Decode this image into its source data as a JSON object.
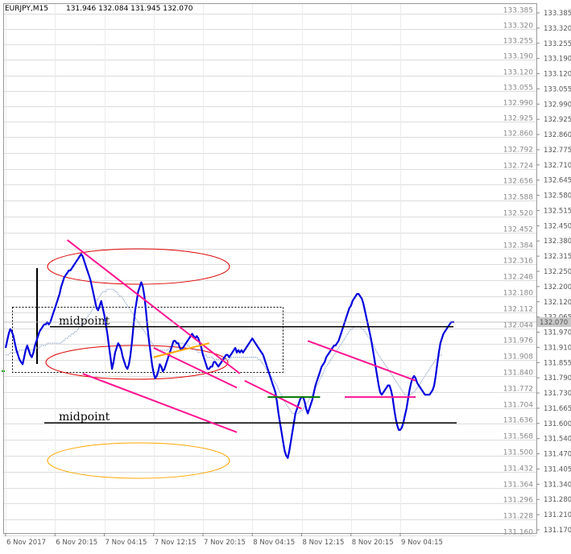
{
  "header": {
    "symbol": "EURJPY,M15",
    "ohlc": "131.946 132.084 131.945 132.070"
  },
  "price_tag": "132.070",
  "colors": {
    "price_line": "#0000dd",
    "ma_line": "#9bb0d0",
    "trendline": "#ff1493",
    "level_line": "#000000",
    "green_line": "#007700",
    "orange_line": "#ffa500",
    "ellipse_red": "#dd0000",
    "ellipse_orange": "#ffa500",
    "grid": "#dcdcdc"
  },
  "chart_data": {
    "type": "line",
    "symbol": "EURJPY",
    "timeframe": "M15",
    "y_axis_ticks": [
      "133.385",
      "133.320",
      "133.255",
      "133.190",
      "133.120",
      "133.055",
      "132.990",
      "132.925",
      "132.860",
      "132.792",
      "132.724",
      "132.656",
      "132.588",
      "132.520",
      "132.452",
      "132.384",
      "132.316",
      "132.248",
      "132.180",
      "132.112",
      "132.044",
      "131.976",
      "131.908",
      "131.840",
      "131.772",
      "131.704",
      "131.636",
      "131.568",
      "131.500",
      "131.432",
      "131.364",
      "131.296",
      "131.228",
      "131.160"
    ],
    "y_axis_ticks_right": [
      "133.385",
      "133.320",
      "133.255",
      "133.190",
      "133.120",
      "133.055",
      "132.990",
      "132.925",
      "132.860",
      "132.775",
      "132.710",
      "132.645",
      "132.580",
      "132.515",
      "132.450",
      "132.380",
      "132.315",
      "132.250",
      "132.200",
      "132.120",
      "132.065",
      "131.970",
      "131.910",
      "131.855",
      "131.790",
      "131.730",
      "131.665",
      "131.600",
      "131.540",
      "131.470",
      "131.405",
      "131.340",
      "131.280",
      "131.210",
      "131.170"
    ],
    "x_axis_ticks": [
      "6 Nov 2017",
      "6 Nov 20:15",
      "7 Nov 04:15",
      "7 Nov 12:15",
      "7 Nov 20:15",
      "8 Nov 04:15",
      "8 Nov 12:15",
      "8 Nov 20:15",
      "9 Nov 04:15"
    ],
    "x_tick_index": [
      0,
      32,
      64,
      96,
      128,
      160,
      192,
      224,
      256
    ],
    "ylim": [
      131.17,
      133.43
    ],
    "annotations": [
      "midpoint",
      "midpoint"
    ],
    "series": [
      {
        "values": [
          131.96,
          131.99,
          132.02,
          132.04,
          132.03,
          132.01,
          131.98,
          131.95,
          131.93,
          131.91,
          131.9,
          131.89,
          131.92,
          131.95,
          131.97,
          131.95,
          131.93,
          131.92,
          131.94,
          131.97,
          131.99,
          132.01,
          132.03,
          132.04,
          132.05,
          132.06,
          132.06,
          132.07,
          132.06,
          132.07,
          132.09,
          132.11,
          132.13,
          132.15,
          132.17,
          132.19,
          132.22,
          132.24,
          132.26,
          132.27,
          132.28,
          132.29,
          132.29,
          132.3,
          132.31,
          132.32,
          132.33,
          132.34,
          132.35,
          132.36,
          132.35,
          132.33,
          132.31,
          132.29,
          132.27,
          132.25,
          132.22,
          132.19,
          132.16,
          132.13,
          132.12,
          132.14,
          132.16,
          132.13,
          132.1,
          132.06,
          132.02,
          131.97,
          131.92,
          131.87,
          131.9,
          131.94,
          131.96,
          131.98,
          131.97,
          131.95,
          131.92,
          131.9,
          131.88,
          131.87,
          131.89,
          131.93,
          131.99,
          132.06,
          132.12,
          132.16,
          132.2,
          132.22,
          132.24,
          132.22,
          132.18,
          132.12,
          132.05,
          131.99,
          131.94,
          131.89,
          131.85,
          131.83,
          131.84,
          131.86,
          131.89,
          131.88,
          131.86,
          131.87,
          131.89,
          131.91,
          131.93,
          131.95,
          131.97,
          131.99,
          131.99,
          131.98,
          131.98,
          131.96,
          131.95,
          131.96,
          131.97,
          131.98,
          131.99,
          132.0,
          132.01,
          132.02,
          132.01,
          132.0,
          132.01,
          132.0,
          131.98,
          131.96,
          131.93,
          131.91,
          131.89,
          131.87,
          131.87,
          131.88,
          131.88,
          131.9,
          131.9,
          131.89,
          131.88,
          131.89,
          131.9,
          131.91,
          131.92,
          131.93,
          131.93,
          131.92,
          131.93,
          131.94,
          131.95,
          131.96,
          131.94,
          131.95,
          131.94,
          131.95,
          131.94,
          131.95,
          131.96,
          131.97,
          131.98,
          131.99,
          132.0,
          131.99,
          131.98,
          131.97,
          131.96,
          131.95,
          131.94,
          131.93,
          131.91,
          131.89,
          131.87,
          131.85,
          131.83,
          131.81,
          131.79,
          131.77,
          131.73,
          131.68,
          131.64,
          131.6,
          131.56,
          131.52,
          131.5,
          131.49,
          131.52,
          131.56,
          131.6,
          131.64,
          131.68,
          131.7,
          131.72,
          131.74,
          131.75,
          131.75,
          131.73,
          131.7,
          131.68,
          131.7,
          131.72,
          131.74,
          131.77,
          131.8,
          131.82,
          131.84,
          131.86,
          131.88,
          131.89,
          131.9,
          131.92,
          131.93,
          131.94,
          131.95,
          131.96,
          131.97,
          131.97,
          131.98,
          131.99,
          132.01,
          132.03,
          132.05,
          132.07,
          132.09,
          132.11,
          132.13,
          132.14,
          132.16,
          132.17,
          132.18,
          132.19,
          132.19,
          132.18,
          132.17,
          132.15,
          132.12,
          132.09,
          132.06,
          132.03,
          132.0,
          131.96,
          131.92,
          131.88,
          131.84,
          131.8,
          131.77,
          131.76,
          131.77,
          131.78,
          131.79,
          131.8,
          131.8,
          131.78,
          131.75,
          131.7,
          131.66,
          131.63,
          131.61,
          131.61,
          131.62,
          131.64,
          131.67,
          131.7,
          131.74,
          131.78,
          131.81,
          131.83,
          131.84,
          131.83,
          131.81,
          131.8,
          131.79,
          131.78,
          131.77,
          131.76,
          131.76,
          131.76,
          131.76,
          131.77,
          131.78,
          131.8,
          131.84,
          131.89,
          131.94,
          131.98,
          132.0,
          132.02,
          132.03,
          132.04,
          132.05,
          132.06,
          132.07,
          132.07,
          132.07
        ]
      },
      {
        "values": [
          131.93,
          131.93,
          131.93,
          131.94,
          131.94,
          131.94,
          131.94,
          131.94,
          131.94,
          131.95,
          131.95,
          131.95,
          131.95,
          131.95,
          131.95,
          131.95,
          131.95,
          131.95,
          131.95,
          131.96,
          131.96,
          131.96,
          131.96,
          131.97,
          131.97,
          131.97,
          131.97,
          131.98,
          131.98,
          131.98,
          131.98,
          131.98,
          131.98,
          131.98,
          131.98,
          131.98,
          131.98,
          131.99,
          131.99,
          132.0,
          132.0,
          132.01,
          132.01,
          132.02,
          132.02,
          132.03,
          132.03,
          132.04,
          132.05,
          132.06,
          132.06,
          132.07,
          132.08,
          132.09,
          132.1,
          132.11,
          132.12,
          132.14,
          132.15,
          132.16,
          132.17,
          132.18,
          132.19,
          132.2,
          132.2,
          132.2,
          132.21,
          132.21,
          132.21,
          132.21,
          132.21,
          132.2,
          132.2,
          132.19,
          132.18,
          132.18,
          132.17,
          132.16,
          132.15,
          132.14,
          132.13,
          132.12,
          132.11,
          132.1,
          132.09,
          132.08,
          132.07,
          132.06,
          132.05,
          132.04,
          132.03,
          132.02,
          132.01,
          132.0,
          131.99,
          131.98,
          131.97,
          131.96,
          131.96,
          131.95,
          131.95,
          131.95,
          131.95,
          131.95,
          131.95,
          131.95,
          131.96,
          131.96,
          131.97,
          131.97,
          131.97,
          131.98,
          131.98,
          131.98,
          131.98,
          131.98,
          131.98,
          131.98,
          131.97,
          131.97,
          131.96,
          131.96,
          131.96,
          131.95,
          131.95,
          131.94,
          131.94,
          131.94,
          131.93,
          131.93,
          131.93,
          131.92,
          131.92,
          131.92,
          131.92,
          131.91,
          131.91,
          131.91,
          131.91,
          131.91,
          131.91,
          131.91,
          131.91,
          131.91,
          131.91,
          131.91,
          131.92,
          131.92,
          131.92,
          131.92,
          131.92,
          131.92,
          131.92,
          131.92,
          131.92,
          131.92,
          131.92,
          131.92,
          131.92,
          131.92,
          131.92,
          131.92,
          131.92,
          131.92,
          131.91,
          131.91,
          131.9,
          131.89,
          131.88,
          131.87,
          131.86,
          131.85,
          131.84,
          131.83,
          131.82,
          131.81,
          131.8,
          131.78,
          131.77,
          131.76,
          131.74,
          131.73,
          131.72,
          131.71,
          131.7,
          131.69,
          131.68,
          131.68,
          131.68,
          131.68,
          131.68,
          131.69,
          131.69,
          131.7,
          131.71,
          131.72,
          131.73,
          131.74,
          131.75,
          131.76,
          131.77,
          131.79,
          131.8,
          131.81,
          131.83,
          131.84,
          131.85,
          131.87,
          131.88,
          131.89,
          131.9,
          131.91,
          131.92,
          131.93,
          131.94,
          131.95,
          131.96,
          131.97,
          131.98,
          131.99,
          132.0,
          132.01,
          132.02,
          132.03,
          132.04,
          132.04,
          132.05,
          132.05,
          132.05,
          132.05,
          132.05,
          132.04,
          132.04,
          132.03,
          132.02,
          132.01,
          132.0,
          131.99,
          131.98,
          131.97,
          131.95,
          131.94,
          131.93,
          131.92,
          131.91,
          131.9,
          131.89,
          131.88,
          131.87,
          131.86,
          131.85,
          131.84,
          131.83,
          131.82,
          131.81,
          131.8,
          131.79,
          131.78,
          131.77,
          131.76,
          131.76,
          131.76,
          131.76,
          131.76,
          131.77,
          131.77,
          131.78,
          131.79,
          131.8,
          131.81,
          131.82,
          131.83,
          131.84,
          131.85,
          131.86,
          131.87,
          131.88,
          131.89,
          131.9,
          131.91,
          131.91,
          131.92,
          131.93,
          131.93
        ]
      }
    ],
    "trendlines": [
      {
        "color": "pink",
        "from": [
          40,
          132.42
        ],
        "to": [
          152,
          131.85
        ]
      },
      {
        "color": "pink",
        "from": [
          50,
          131.85
        ],
        "to": [
          150,
          131.6
        ]
      },
      {
        "color": "pink",
        "from": [
          96,
          131.96
        ],
        "to": [
          150,
          131.79
        ]
      },
      {
        "color": "pink",
        "from": [
          155,
          131.82
        ],
        "to": [
          192,
          131.7
        ]
      },
      {
        "color": "pink",
        "from": [
          196,
          131.99
        ],
        "to": [
          266,
          131.82
        ]
      },
      {
        "color": "pink",
        "from": [
          220,
          131.75
        ],
        "to": [
          266,
          131.75
        ]
      },
      {
        "color": "orange",
        "from": [
          96,
          131.92
        ],
        "to": [
          132,
          131.98
        ]
      },
      {
        "color": "green",
        "from": [
          170,
          131.75
        ],
        "to": [
          204,
          131.75
        ]
      }
    ],
    "levels": [
      {
        "label": "midpoint",
        "value": 132.05
      },
      {
        "label": "midpoint",
        "value": 131.64
      }
    ]
  }
}
